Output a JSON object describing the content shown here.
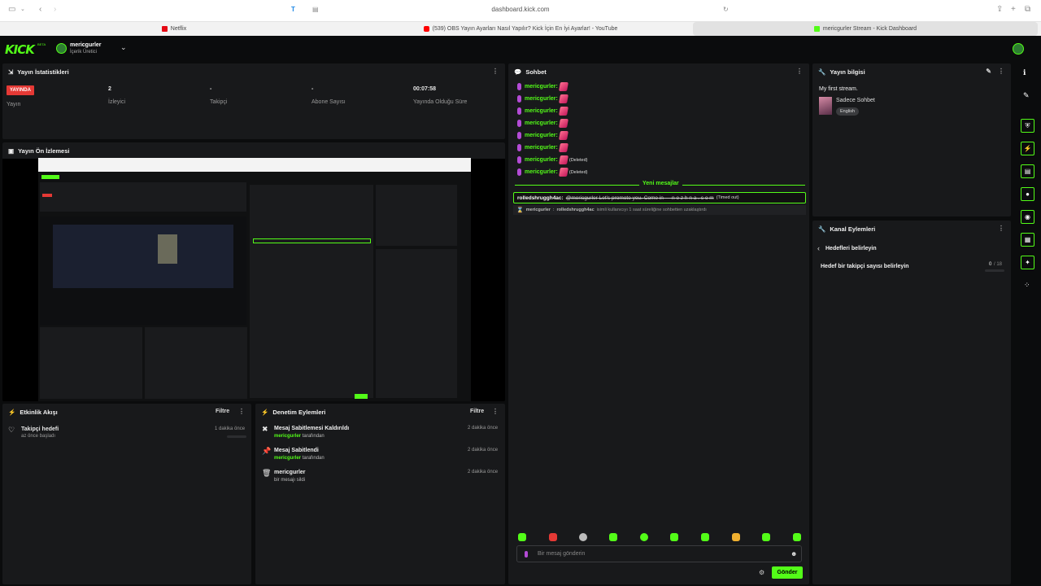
{
  "browser": {
    "url": "dashboard.kick.com",
    "tabs": [
      {
        "label": "Netflix",
        "color": "#e50914"
      },
      {
        "label": "(539) OBS Yayın Ayarları Nasıl Yapılır? Kick İçin En İyi Ayarlar! - YouTube",
        "color": "#ff0000"
      },
      {
        "label": "mericgurler Stream - Kick Dashboard",
        "color": "#53fc18"
      }
    ]
  },
  "header": {
    "logo": "KICK",
    "beta": "BETA",
    "username": "mericgurler",
    "role": "İçerik Üretici"
  },
  "stats": {
    "title": "Yayın İstatistikleri",
    "live_badge": "YAYINDA",
    "live_label": "Yayın",
    "viewers_value": "2",
    "viewers_label": "İzleyici",
    "followers_value": "-",
    "followers_label": "Takipçi",
    "subs_value": "-",
    "subs_label": "Abone Sayısı",
    "duration_value": "00:07:58",
    "duration_label": "Yayında Olduğu Süre"
  },
  "preview": {
    "title": "Yayın Ön İzlemesi"
  },
  "activity": {
    "title": "Etkinlik Akışı",
    "filter": "Filtre",
    "items": [
      {
        "title": "Takipçi hedefi",
        "sub": "az önce başladı",
        "time": "1 dakika önce"
      }
    ]
  },
  "moderation": {
    "title": "Denetim Eylemleri",
    "filter": "Filtre",
    "items": [
      {
        "title": "Mesaj Sabitlemesi Kaldırıldı",
        "user": "mericgurler",
        "suffix": "tarafından",
        "time": "2 dakika önce"
      },
      {
        "title": "Mesaj Sabitlendi",
        "user": "mericgurler",
        "suffix": "tarafından",
        "time": "2 dakika önce"
      },
      {
        "title": "mericgurler",
        "user": "",
        "suffix": "bir mesajı sildi",
        "time": "2 dakika önce"
      }
    ]
  },
  "chat": {
    "title": "Sohbet",
    "messages": [
      {
        "user": "mericgurler:",
        "note": ""
      },
      {
        "user": "mericgurler:",
        "note": ""
      },
      {
        "user": "mericgurler:",
        "note": ""
      },
      {
        "user": "mericgurler:",
        "note": ""
      },
      {
        "user": "mericgurler:",
        "note": ""
      },
      {
        "user": "mericgurler:",
        "note": ""
      },
      {
        "user": "mericgurler:",
        "note": "(Deleted)"
      },
      {
        "user": "mericgurler:",
        "note": "(Deleted)"
      }
    ],
    "new_messages": "Yeni mesajlar",
    "timeout_user": "rolledshruggh4ac:",
    "timeout_text": "@mericgurler Let's promote you. Come in — n e z h n a . c o m",
    "timeout_tag": "(Timed out)",
    "system_user": "mericgurler",
    "system_target": "rolledshruggh4ac",
    "system_text": "isimli kullanıcıyı 1 saat süreliğine sohbetten uzaklaştırdı",
    "input_placeholder": "Bir mesaj gönderin",
    "send": "Gönder"
  },
  "stream_info": {
    "title": "Yayın bilgisi",
    "stream_title": "My first stream.",
    "category": "Sadece Sohbet",
    "language": "English"
  },
  "channel_actions": {
    "title": "Kanal Eylemleri",
    "back_label": "Hedefleri belirleyin",
    "goal_label": "Hedef bir takipçi sayısı belirleyin",
    "goal_current": "0",
    "goal_target": "/ 18"
  }
}
